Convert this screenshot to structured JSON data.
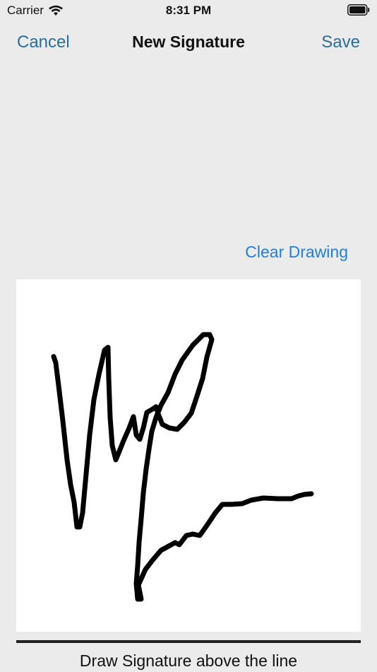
{
  "status_bar": {
    "carrier": "Carrier",
    "time": "8:31 PM",
    "wifi_icon": "wifi-icon",
    "battery_icon": "battery-icon"
  },
  "nav": {
    "cancel_label": "Cancel",
    "title": "New Signature",
    "save_label": "Save"
  },
  "signature_pad": {
    "clear_label": "Clear Drawing",
    "caption": "Draw Signature above the line"
  },
  "colors": {
    "background": "#ebebeb",
    "nav_button": "#2a6d9a",
    "link_blue": "#1f7fe0",
    "ink": "#000000",
    "canvas": "#ffffff"
  }
}
